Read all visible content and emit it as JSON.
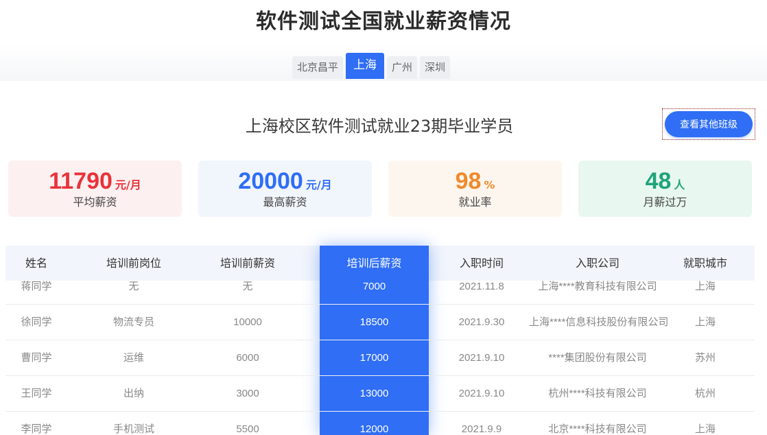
{
  "page_title": "软件测试全国就业薪资情况",
  "city_tabs": [
    {
      "label": "北京昌平",
      "active": false
    },
    {
      "label": "上海",
      "active": true
    },
    {
      "label": "广州",
      "active": false
    },
    {
      "label": "深圳",
      "active": false
    }
  ],
  "section_subtitle": "上海校区软件测试就业23期毕业学员",
  "other_class_button": "查看其他班级",
  "stats": [
    {
      "value": "11790",
      "unit": "元/月",
      "label": "平均薪资",
      "color": "#e8333a",
      "bg": "#fdf0f1"
    },
    {
      "value": "20000",
      "unit": "元/月",
      "label": "最高薪资",
      "color": "#2f6ef5",
      "bg": "#f1f5fc"
    },
    {
      "value": "98",
      "unit": "%",
      "label": "就业率",
      "color": "#f08a2c",
      "bg": "#fdf6ef"
    },
    {
      "value": "48",
      "unit": "人",
      "label": "月薪过万",
      "color": "#1fa37a",
      "bg": "#e8f7ef"
    }
  ],
  "table": {
    "headers": [
      "姓名",
      "培训前岗位",
      "培训前薪资",
      "培训后薪资",
      "入职时间",
      "入职公司",
      "就职城市"
    ],
    "rows": [
      [
        "蒋同学",
        "无",
        "无",
        "7000",
        "2021.11.8",
        "上海****教育科技有限公司",
        "上海"
      ],
      [
        "徐同学",
        "物流专员",
        "10000",
        "18500",
        "2021.9.30",
        "上海****信息科技股份有限公司",
        "上海"
      ],
      [
        "曹同学",
        "运维",
        "6000",
        "17000",
        "2021.9.10",
        "****集团股份有限公司",
        "苏州"
      ],
      [
        "王同学",
        "出纳",
        "3000",
        "13000",
        "2021.9.10",
        "杭州****科技有限公司",
        "杭州"
      ],
      [
        "李同学",
        "手机测试",
        "5500",
        "12000",
        "2021.9.9",
        "北京****科技有限公司",
        "上海"
      ]
    ]
  },
  "accent_color": "#2f6ef5"
}
